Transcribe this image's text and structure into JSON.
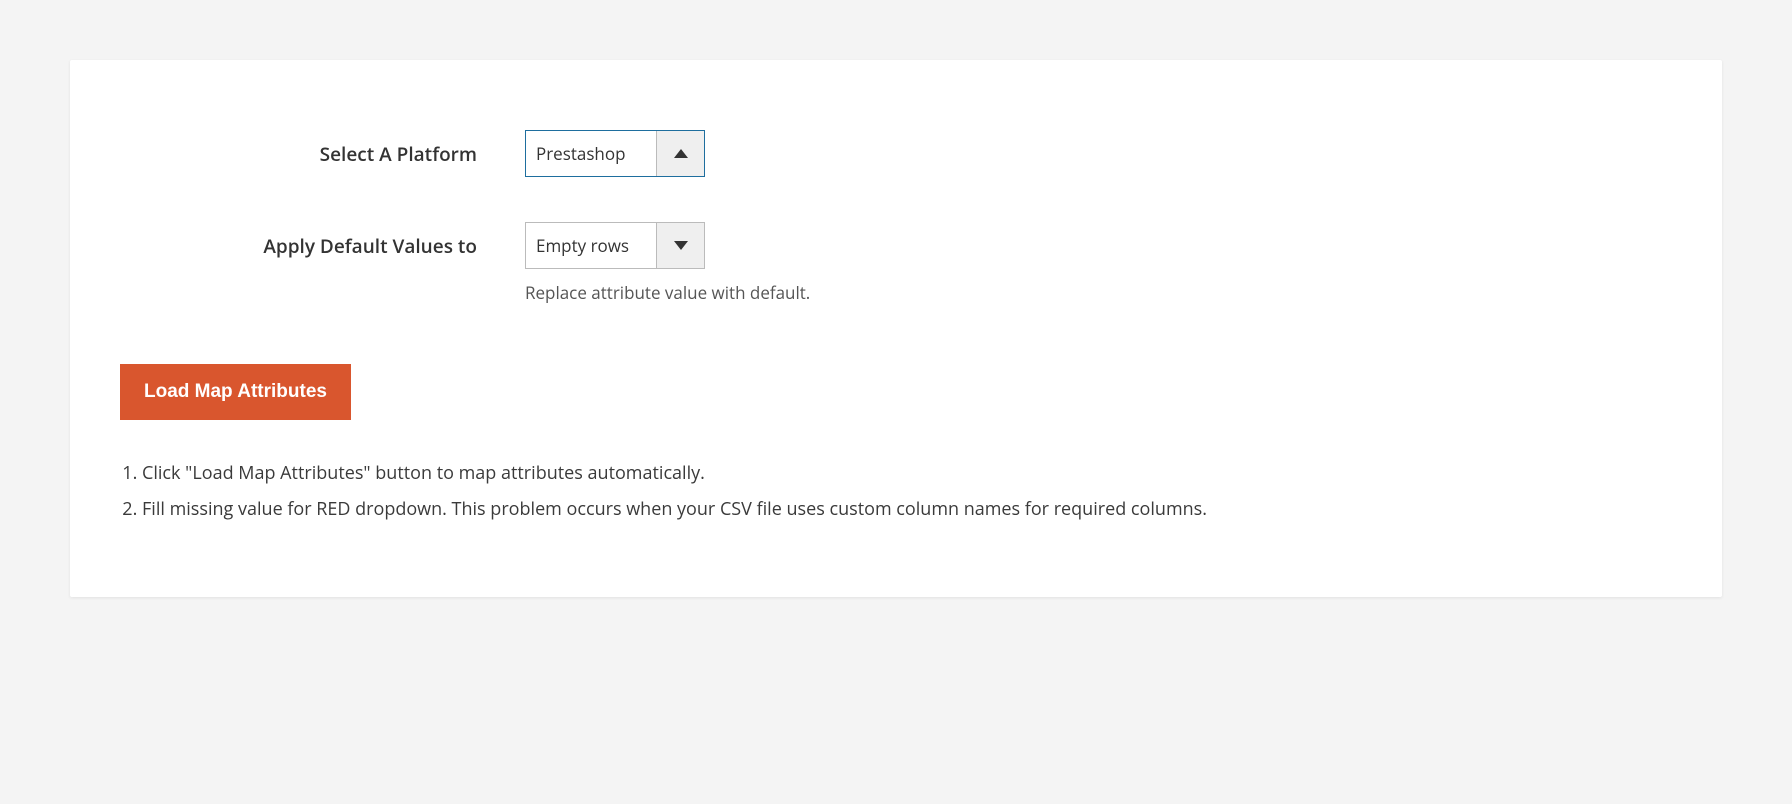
{
  "form": {
    "platform": {
      "label": "Select A Platform",
      "value": "Prestashop",
      "expanded": true
    },
    "defaultValues": {
      "label": "Apply Default Values to",
      "value": "Empty rows",
      "helper": "Replace attribute value with default."
    }
  },
  "actions": {
    "loadMap": "Load Map Attributes"
  },
  "instructions": [
    "Click \"Load Map Attributes\" button to map attributes automatically.",
    "Fill missing value for RED dropdown. This problem occurs when your CSV file uses custom column names for required columns."
  ]
}
